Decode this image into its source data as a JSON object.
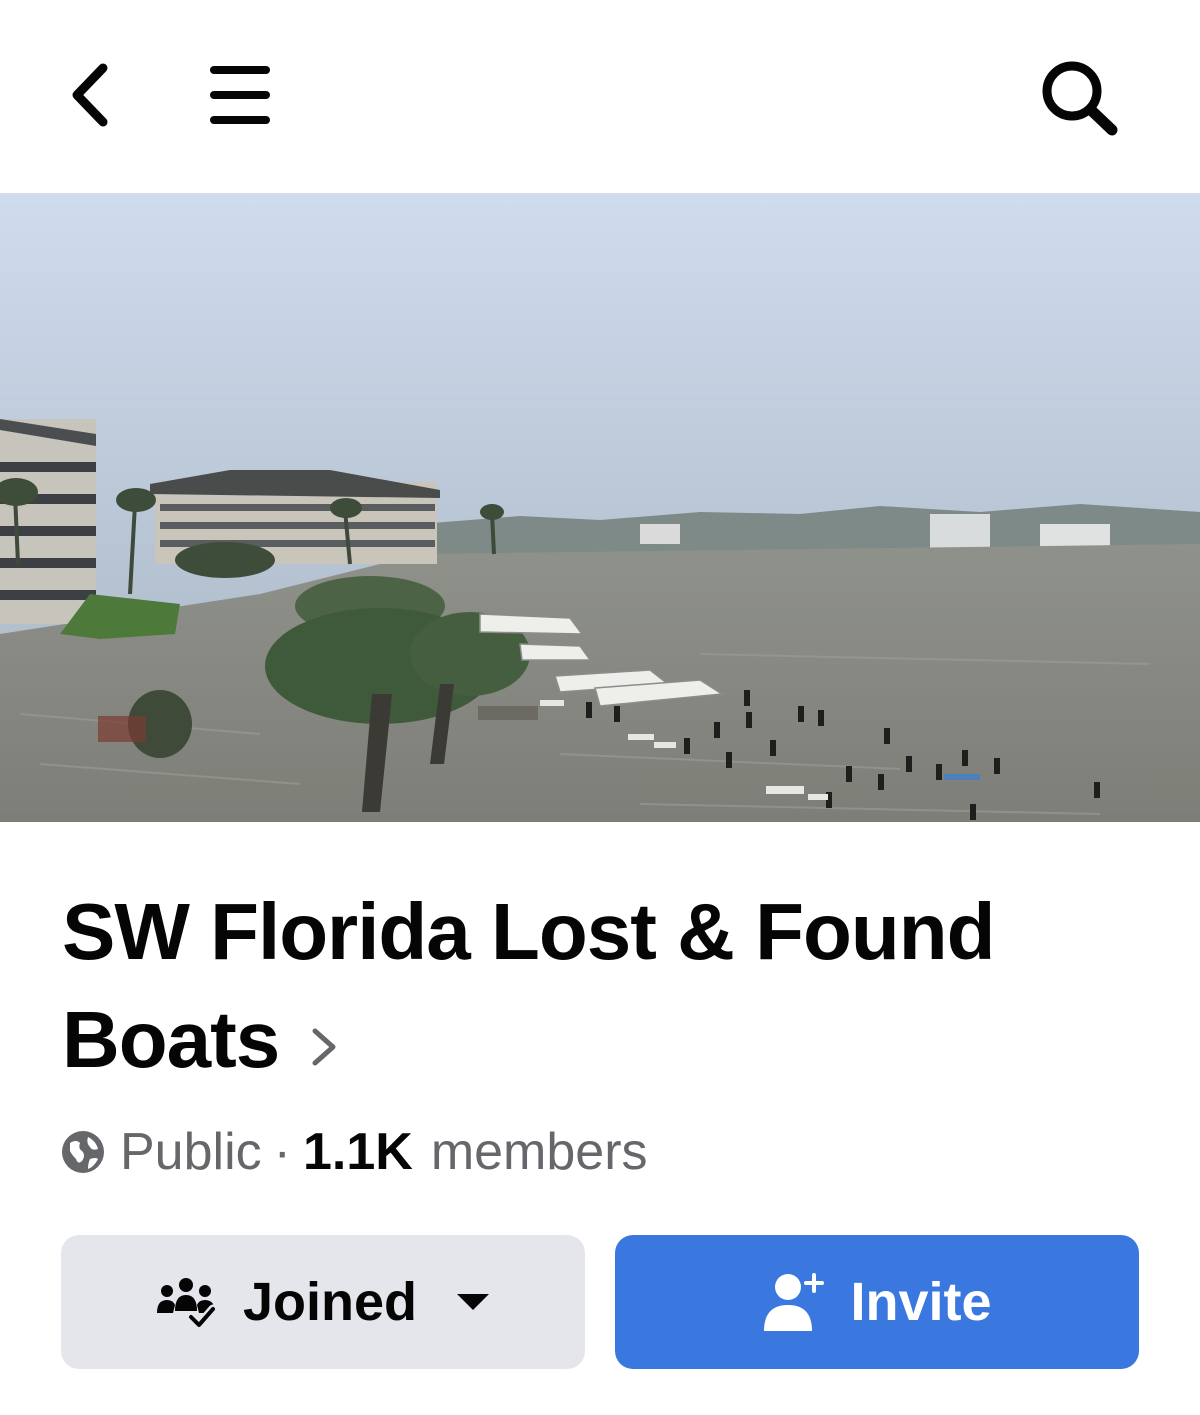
{
  "header": {
    "back_icon": "chevron-left-icon",
    "menu_icon": "hamburger-menu-icon",
    "search_icon": "search-icon"
  },
  "cover": {
    "image": "flooded-marina-cover-photo"
  },
  "group": {
    "title": "SW Florida Lost & Found Boats",
    "privacy_icon": "globe-icon",
    "privacy": "Public",
    "separator": "·",
    "member_count": "1.1K",
    "members_label": "members"
  },
  "actions": {
    "joined_label": "Joined",
    "joined_icon": "group-check-icon",
    "invite_label": "Invite",
    "invite_icon": "add-person-icon"
  },
  "colors": {
    "invite_bg": "#3a78e0",
    "joined_bg": "#e4e6eb",
    "text_primary": "#050505",
    "text_secondary": "#65676b"
  }
}
